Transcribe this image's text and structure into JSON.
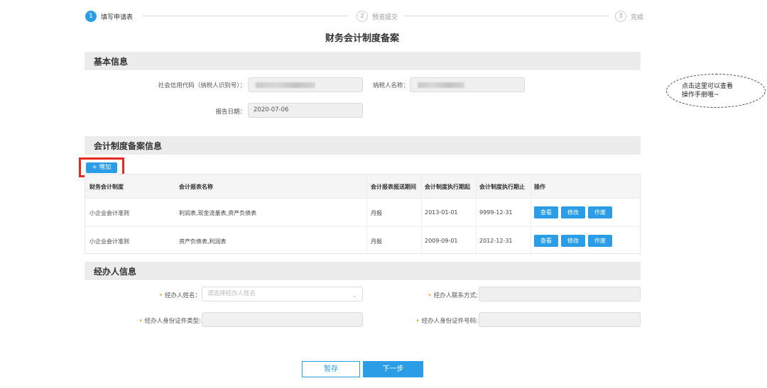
{
  "steps": [
    {
      "num": "1",
      "label": "填写申请表"
    },
    {
      "num": "2",
      "label": "预览提交"
    },
    {
      "num": "3",
      "label": "完成"
    }
  ],
  "page_title": "财务会计制度备案",
  "basic_info": {
    "header": "基本信息",
    "credit_code_label": "社会信用代码（纳税人识别号）：",
    "taxpayer_name_label": "纳税人名称：",
    "report_date_label": "报告日期：",
    "report_date_value": "2020-07-06"
  },
  "accounting": {
    "header": "会计制度备案信息",
    "add_label": "+ 增加",
    "columns": [
      "财务会计制度",
      "会计报表名称",
      "会计报表报送期间",
      "会计制度执行期起",
      "会计制度执行期止",
      "操作"
    ],
    "rows": [
      {
        "system": "小企业会计准则",
        "reports": "利润表,现金流量表,资产负债表",
        "period": "月报",
        "start": "2013-01-01",
        "end": "9999-12-31"
      },
      {
        "system": "小企业会计准则",
        "reports": "资产负债表,利润表",
        "period": "月报",
        "start": "2009-09-01",
        "end": "2012-12-31"
      }
    ],
    "actions": {
      "view": "查看",
      "edit": "修改",
      "void": "作废"
    }
  },
  "handler": {
    "header": "经办人信息",
    "name_label": "经办人姓名：",
    "name_placeholder": "请选择经办人姓名",
    "contact_label": "经办人联系方式:",
    "id_type_label": "经办人身份证件类型:",
    "id_number_label": "经办人身份证件号码:",
    "required_mark": "•"
  },
  "tip_bubble": {
    "line1": "点击这里可以查看",
    "line2": "操作手册哦~"
  },
  "buttons": {
    "save": "暂存",
    "next": "下一步"
  },
  "colors": {
    "accent": "#2a9de6",
    "highlight": "#e82a1e"
  }
}
